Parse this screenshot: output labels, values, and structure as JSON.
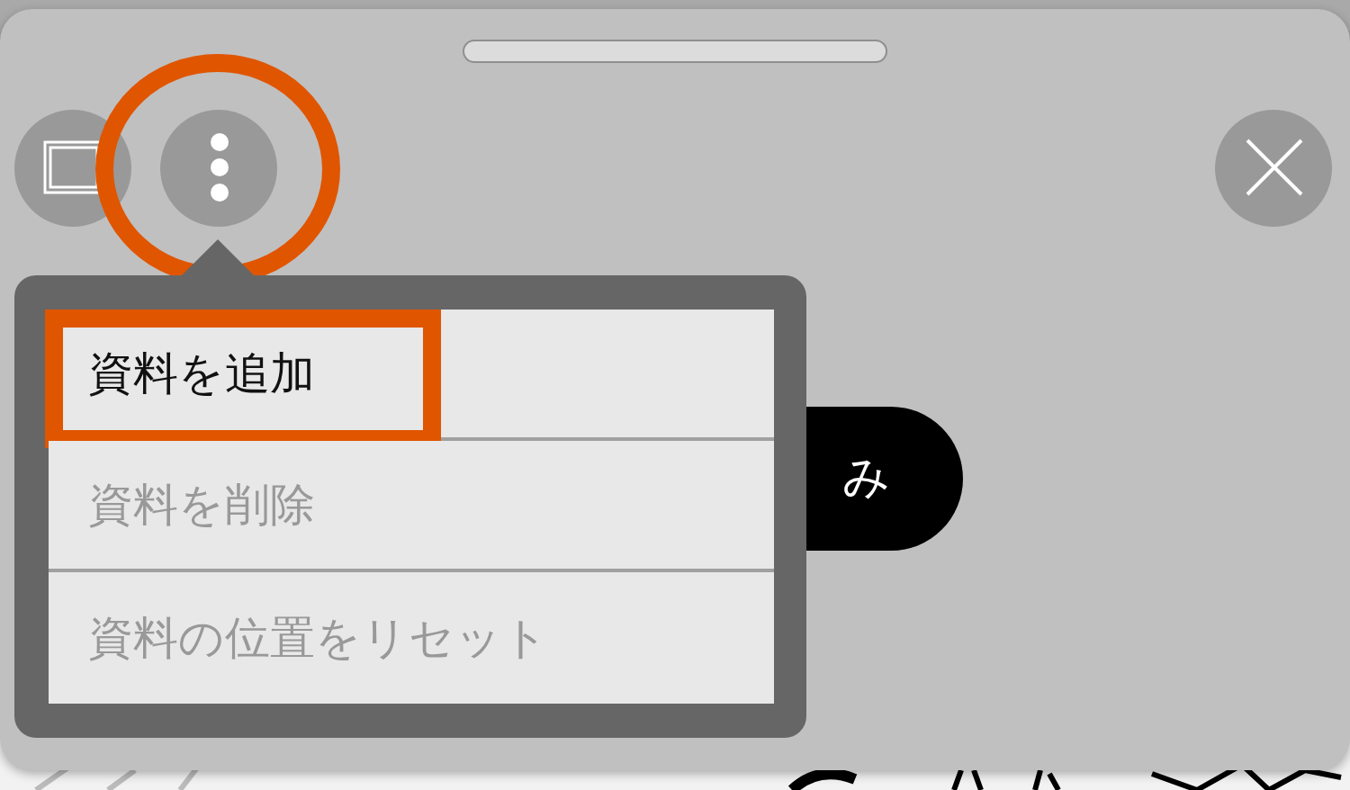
{
  "toolbar": {
    "buttons": [
      {
        "kind": "frame",
        "highlighted": false
      },
      {
        "kind": "more",
        "highlighted": true
      }
    ],
    "close": {
      "kind": "close"
    }
  },
  "background_button": {
    "label": "み"
  },
  "menu": {
    "items": [
      {
        "label": "資料を追加",
        "disabled": false,
        "highlighted": true
      },
      {
        "label": "資料を削除",
        "disabled": true,
        "highlighted": false
      },
      {
        "label": "資料の位置をリセット",
        "disabled": true,
        "highlighted": false
      }
    ]
  }
}
